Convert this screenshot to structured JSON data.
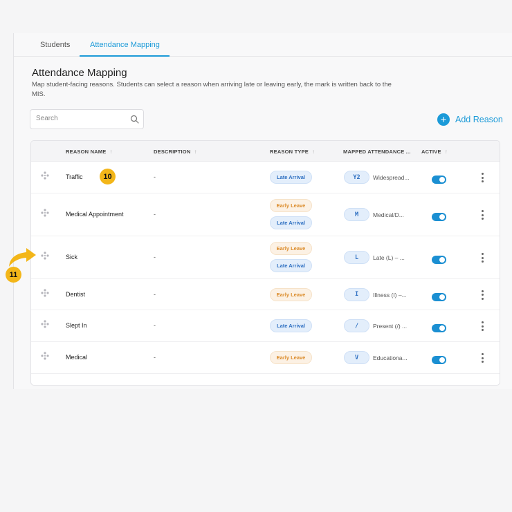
{
  "tabs": [
    {
      "label": "Students",
      "active": false
    },
    {
      "label": "Attendance Mapping",
      "active": true
    }
  ],
  "page": {
    "title": "Attendance Mapping",
    "subtitle": "Map student-facing reasons. Students can select a reason when arriving late or leaving early, the mark is written back to the MIS."
  },
  "search": {
    "placeholder": "Search",
    "value": ""
  },
  "add_button": {
    "label": "Add Reason"
  },
  "table": {
    "headers": {
      "reason_name": "REASON NAME",
      "description": "DESCRIPTION",
      "reason_type": "REASON TYPE",
      "mapped": "MAPPED ATTENDANCE ...",
      "active": "ACTIVE"
    },
    "rows": [
      {
        "name": "Traffic",
        "description": "-",
        "types": [
          "Late Arrival"
        ],
        "code": "Y2",
        "code_desc": "Widespread...",
        "active": true
      },
      {
        "name": "Medical Appointment",
        "description": "-",
        "types": [
          "Early Leave",
          "Late Arrival"
        ],
        "code": "M",
        "code_desc": "Medical/D...",
        "active": true
      },
      {
        "name": "Sick",
        "description": "-",
        "types": [
          "Early Leave",
          "Late Arrival"
        ],
        "code": "L",
        "code_desc": "Late (L) – ...",
        "active": true
      },
      {
        "name": "Dentist",
        "description": "-",
        "types": [
          "Early Leave"
        ],
        "code": "I",
        "code_desc": "Illness (I) –...",
        "active": true
      },
      {
        "name": "Slept In",
        "description": "-",
        "types": [
          "Late Arrival"
        ],
        "code": "/",
        "code_desc": "Present (/) ...",
        "active": true
      },
      {
        "name": "Medical",
        "description": "-",
        "types": [
          "Early Leave"
        ],
        "code": "V",
        "code_desc": "Educationa...",
        "active": true
      }
    ]
  },
  "annotations": {
    "step_10": "10",
    "step_11": "11"
  },
  "colors": {
    "accent": "#1b9ad8",
    "late_arrival_bg": "#e3eefb",
    "late_arrival_text": "#2d6fc1",
    "early_leave_bg": "#fcf1e4",
    "early_leave_text": "#db8b29",
    "annotation": "#f3b619"
  },
  "icons": {
    "search": "search-icon",
    "add": "plus-circle-icon",
    "drag": "drag-handle-icon",
    "row_menu": "kebab-menu-icon",
    "sort": "sort-arrow-icon"
  }
}
